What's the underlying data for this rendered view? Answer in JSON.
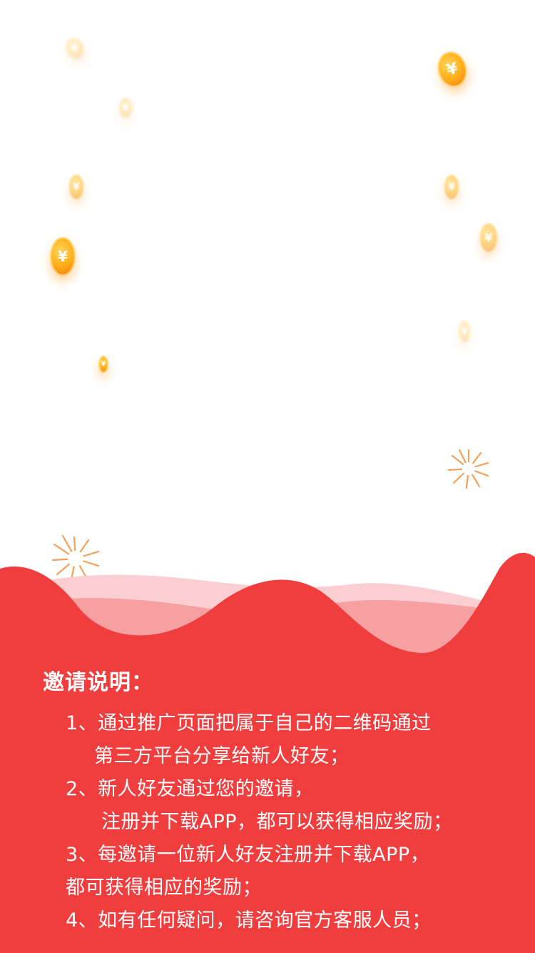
{
  "coin_symbol": "¥",
  "colors": {
    "background": "#ffffff",
    "red": "#f03e3f",
    "wave_light": "#fbcfd1",
    "wave_mid": "#f7a0a2",
    "coin": "#ffb21e",
    "firework": "#f5a05a"
  },
  "instructions": {
    "title": "邀请说明：",
    "lines": [
      "1、通过推广页面把属于自己的二维码通过",
      "第三方平台分享给新人好友；",
      "2、新人好友通过您的邀请，",
      "注册并下载APP，都可以获得相应奖励；",
      "3、每邀请一位新人好友注册并下载APP，",
      "都可获得相应的奖励；",
      "4、如有任何疑问，请咨询官方客服人员；"
    ]
  }
}
